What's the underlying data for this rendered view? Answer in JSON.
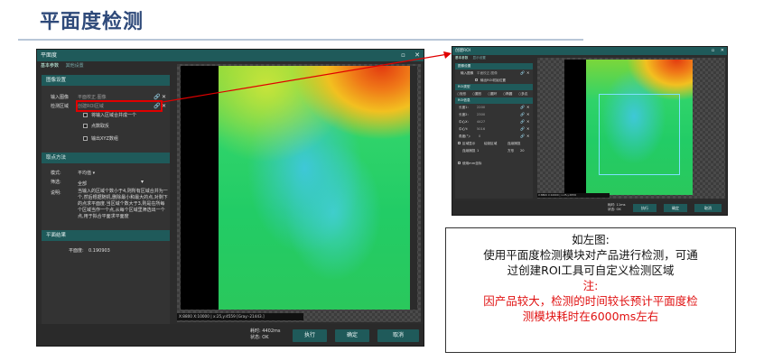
{
  "slide": {
    "title": "平面度检测"
  },
  "main_dialog": {
    "title": "平面度",
    "tabs": [
      "基本参数",
      "其他设置"
    ],
    "section_image": "图像设置",
    "input_image_label": "输入图像",
    "input_image_value": "平面校正.图像",
    "detect_region_label": "检测区域",
    "detect_region_value": "创建ROI区域",
    "check_merge": "将输入区域合并成一个",
    "check_points": "点数取反",
    "check_output": "输出XYZ数组",
    "section_method": "取点方法",
    "mode_label": "模式:",
    "mode_value": "平均值",
    "filter_label": "筛选:",
    "filter_value": "全部",
    "desc_label": "说明:",
    "desc_text": "当输入的区域个数小于4,则所有区域合并为一个,然后根据随机,删除最小和最大的点,对剩下的点求平面度.当区域个数大于3,则是在所每个区域当作一个点,从每个区域里筛选出一个点,用于拟合平面求平面度",
    "section_result": "平面结果",
    "flatness_label": "平面度:",
    "flatness_value": "0.190903",
    "status_line": "X:8800 X:10000 | x:25,y:4559 [Gray:-21443.]",
    "elapsed": "耗时: 4402ms",
    "state": "状态: OK",
    "btn_run": "执行",
    "btn_ok": "确定",
    "btn_cancel": "取消"
  },
  "roi_dialog": {
    "title": "创建ROI",
    "tabs": [
      "基本参数",
      "显示设置"
    ],
    "section_image": "图像设置",
    "input_label": "输入图像",
    "input_value": "平面校正.图像",
    "check_origin": "输出ROI初始位置",
    "section_shape": "ROI类型",
    "shapes": [
      "矩形",
      "圆形",
      "圆环",
      "椭圆",
      "多边"
    ],
    "section_roi": "ROI信息",
    "fields": [
      {
        "label": "长度1:",
        "value": "2200"
      },
      {
        "label": "长度2:",
        "value": "2300"
      },
      {
        "label": "中心X:",
        "value": "4427"
      },
      {
        "label": "中心Y:",
        "value": "5016"
      },
      {
        "label": "角度(°):",
        "value": "0"
      }
    ],
    "opts": [
      "区域显示",
      "绘制区域",
      "连续捕捉"
    ],
    "width_label": "连续捕捉",
    "width_value": "1",
    "width_max": "20",
    "width_unit": "方形",
    "check_mm": "使用mm坐标",
    "status_line": "X:8800 X:10000 | x:25,y:4559",
    "elapsed": "耗时: 11ms",
    "state": "状态: OK",
    "btn_run": "执行",
    "btn_ok": "确定",
    "btn_cancel": "取消"
  },
  "note": {
    "line1": "如左图:",
    "line2": "使用平面度检测模块对产品进行检测，可通",
    "line3": "过创建ROI工具可自定义检测区域",
    "line4": "注:",
    "line5": "因产品较大，检测的时间较长预计平面度检",
    "line6": "测模块耗时在6000ms左右"
  },
  "colors": {
    "accent": "#1f5a5a",
    "highlight": "#e00000",
    "title": "#2f4a7a"
  }
}
